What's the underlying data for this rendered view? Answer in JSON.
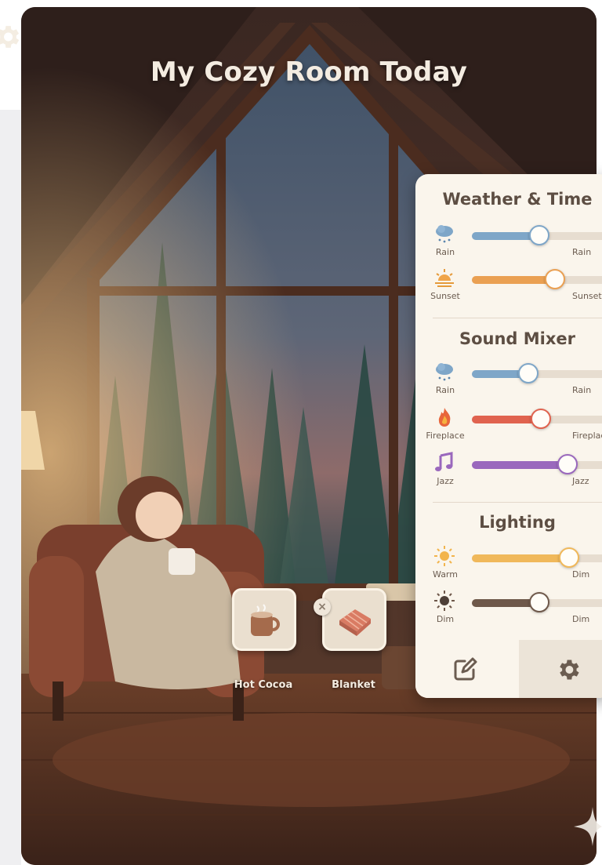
{
  "title": "My Cozy Room Today",
  "panel": {
    "sections": [
      {
        "title": "Weather & Time",
        "rows": [
          {
            "icon": "rain-cloud-icon",
            "label": "Rain",
            "right_label": "Rain",
            "value": 0.43,
            "color": "#7ea6c8"
          },
          {
            "icon": "sunset-icon",
            "label": "Sunset",
            "right_label": "Sunset",
            "value": 0.53,
            "color": "#eaa052"
          }
        ]
      },
      {
        "title": "Sound Mixer",
        "rows": [
          {
            "icon": "rain-cloud-icon",
            "label": "Rain",
            "right_label": "Rain",
            "value": 0.36,
            "color": "#7ea6c8"
          },
          {
            "icon": "fire-icon",
            "label": "Fireplace",
            "right_label": "Fireplace",
            "value": 0.44,
            "color": "#e0634f"
          },
          {
            "icon": "music-note-icon",
            "label": "Jazz",
            "right_label": "Jazz",
            "value": 0.61,
            "color": "#9a68bd"
          }
        ]
      },
      {
        "title": "Lighting",
        "rows": [
          {
            "icon": "sun-icon",
            "label": "Warm",
            "right_label": "Dim",
            "value": 0.62,
            "color": "#f0b85a"
          },
          {
            "icon": "dim-sun-icon",
            "label": "Dim",
            "right_label": "Dim",
            "value": 0.43,
            "color": "#6e584a"
          }
        ]
      }
    ],
    "tabs": [
      {
        "icon": "edit-icon",
        "active": false
      },
      {
        "icon": "gear-icon",
        "active": true
      }
    ]
  },
  "items": [
    {
      "icon": "mug-icon",
      "label": "Hot Cocoa"
    },
    {
      "icon": "blanket-icon",
      "label": "Blanket"
    }
  ],
  "remove_badge": "×"
}
